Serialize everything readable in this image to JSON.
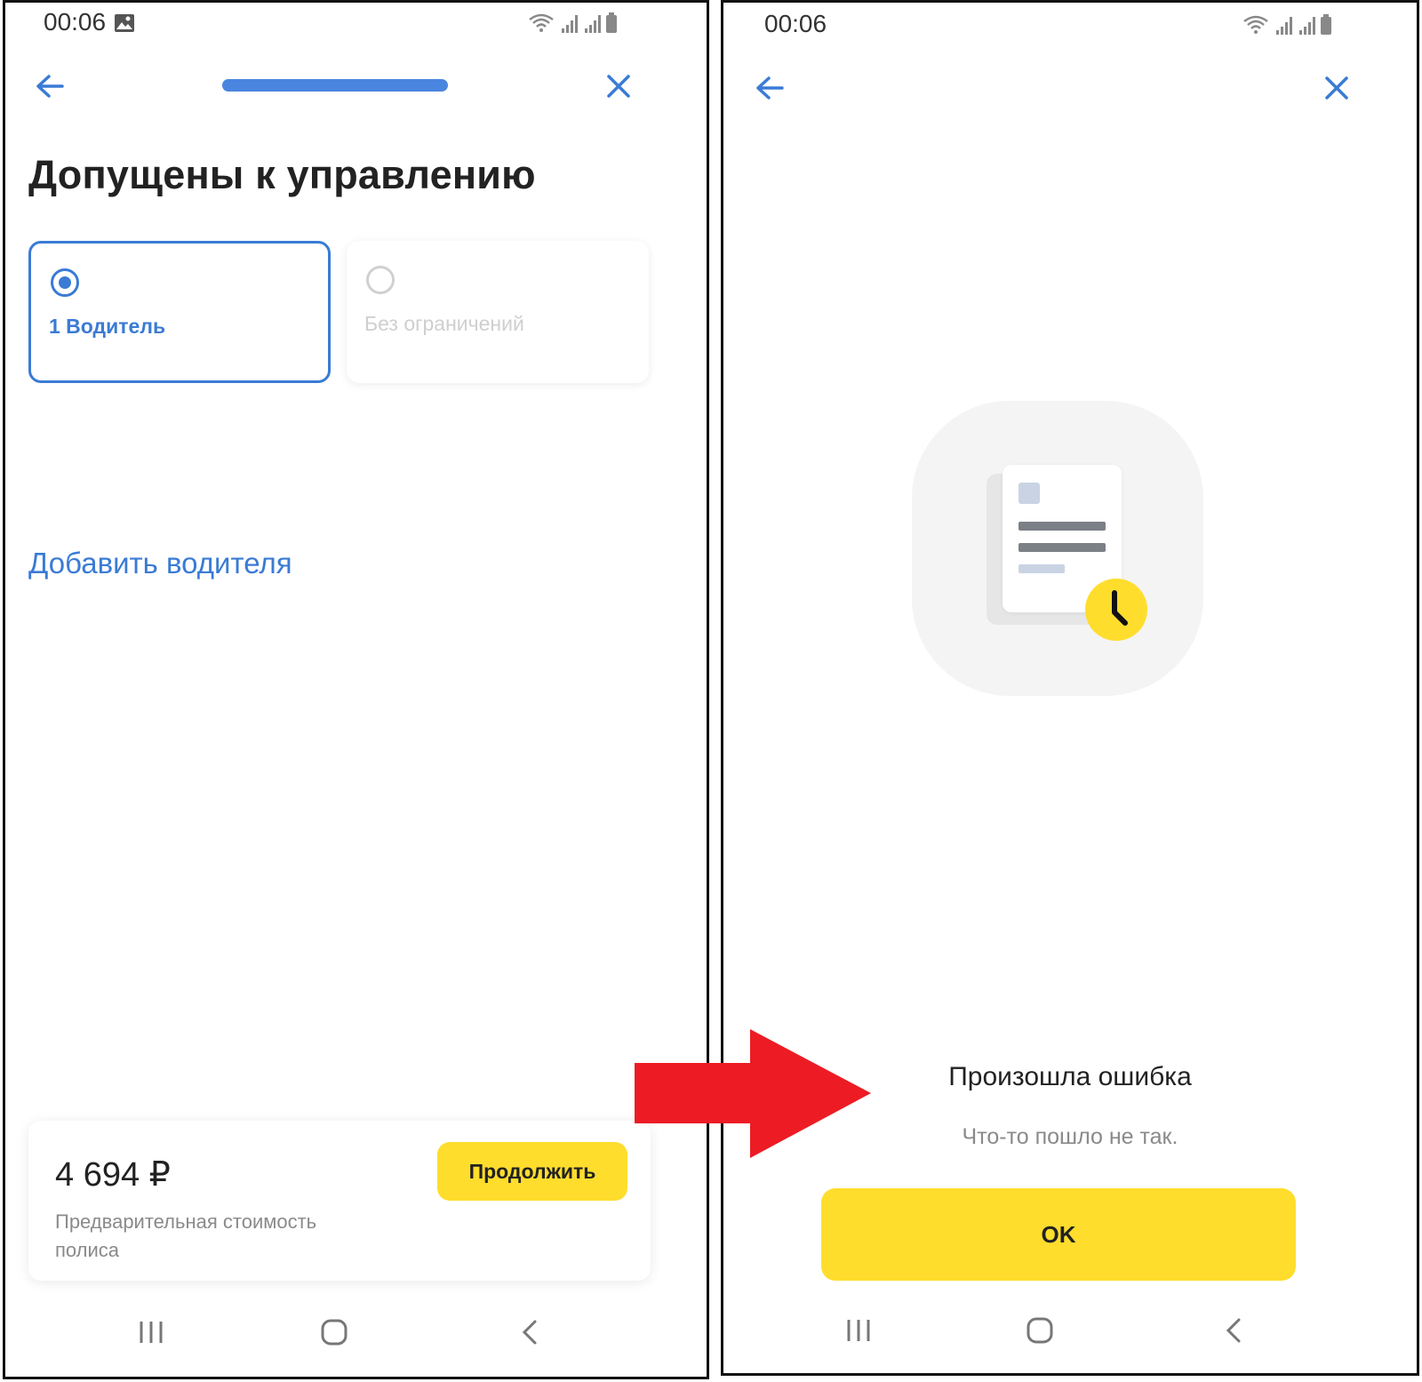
{
  "colors": {
    "accent": "#3a7bd5",
    "button_yellow": "#ffdd2d",
    "arrow_red": "#ed1c24"
  },
  "left_screen": {
    "status": {
      "time": "00:06",
      "icons": [
        "image-icon",
        "wifi-icon",
        "signal-icon",
        "signal-icon",
        "battery-icon"
      ]
    },
    "header": {
      "back_icon": "arrow-left-icon",
      "close_icon": "close-icon",
      "progress": 1.0
    },
    "title": "Допущены к управлению",
    "options": [
      {
        "label": "1 Водитель",
        "selected": true
      },
      {
        "label": "Без ограничений",
        "selected": false
      }
    ],
    "add_driver_link": "Добавить водителя",
    "price_card": {
      "price": "4 694 ₽",
      "caption": "Предварительная стоимость полиса",
      "continue_label": "Продолжить"
    },
    "system_nav": [
      "recents-icon",
      "home-icon",
      "back-icon"
    ]
  },
  "right_screen": {
    "status": {
      "time": "00:06",
      "icons": [
        "wifi-icon",
        "signal-icon",
        "signal-icon",
        "battery-icon"
      ]
    },
    "header": {
      "back_icon": "arrow-left-icon",
      "close_icon": "close-icon"
    },
    "illustration": "document-clock-icon",
    "error_title": "Произошла ошибка",
    "error_text": "Что-то пошло не так.",
    "ok_label": "OK",
    "system_nav": [
      "recents-icon",
      "home-icon",
      "back-icon"
    ]
  },
  "annotation": {
    "arrow": "red-arrow-right"
  }
}
